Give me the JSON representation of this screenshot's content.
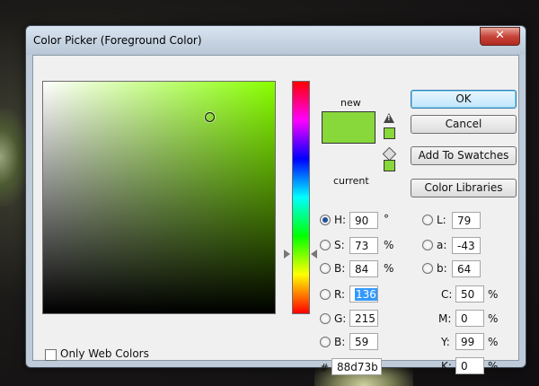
{
  "window": {
    "title": "Color Picker (Foreground Color)",
    "close_glyph": "✕"
  },
  "preview": {
    "new_label": "new",
    "current_label": "current",
    "new_color": "#88d73b",
    "current_color": "#88d73b"
  },
  "buttons": {
    "ok": "OK",
    "cancel": "Cancel",
    "add_swatches": "Add To Swatches",
    "color_libraries": "Color Libraries"
  },
  "hsb": {
    "h": {
      "label": "H:",
      "value": "90",
      "unit": "°"
    },
    "s": {
      "label": "S:",
      "value": "73",
      "unit": "%"
    },
    "b": {
      "label": "B:",
      "value": "84",
      "unit": "%"
    }
  },
  "rgb": {
    "r": {
      "label": "R:",
      "value": "136"
    },
    "g": {
      "label": "G:",
      "value": "215"
    },
    "b": {
      "label": "B:",
      "value": "59"
    }
  },
  "lab": {
    "l": {
      "label": "L:",
      "value": "79"
    },
    "a": {
      "label": "a:",
      "value": "-43"
    },
    "b": {
      "label": "b:",
      "value": "64"
    }
  },
  "cmyk": {
    "c": {
      "label": "C:",
      "value": "50",
      "unit": "%"
    },
    "m": {
      "label": "M:",
      "value": "0",
      "unit": "%"
    },
    "y": {
      "label": "Y:",
      "value": "99",
      "unit": "%"
    },
    "k": {
      "label": "K:",
      "value": "0",
      "unit": "%"
    }
  },
  "hex": {
    "label": "#",
    "value": "88d73b"
  },
  "only_web_colors": {
    "label": "Only Web Colors",
    "checked": false
  },
  "selected_mode": "H",
  "icons": {
    "warning": "gamut-warning-icon",
    "cube": "web-safe-cube-icon"
  }
}
